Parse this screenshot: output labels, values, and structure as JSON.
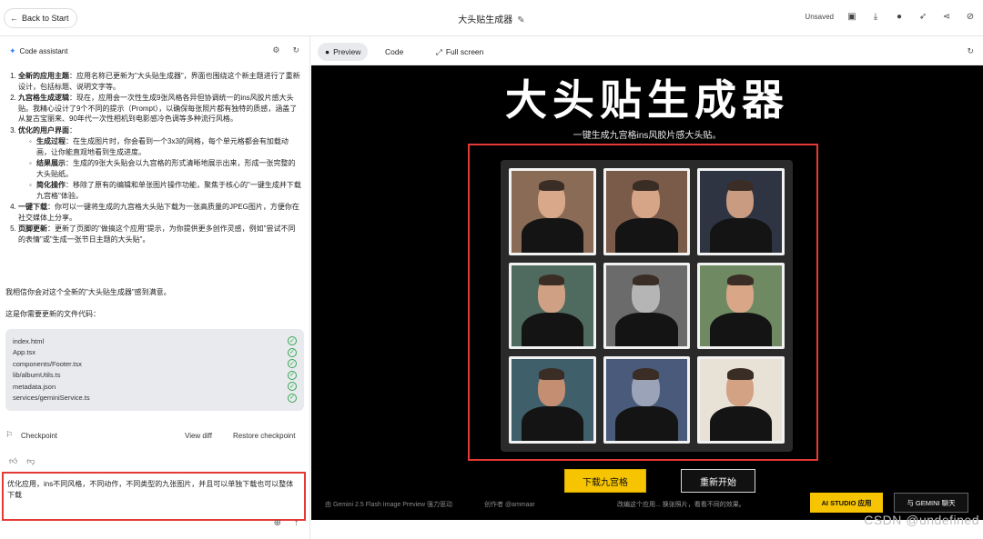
{
  "topbar": {
    "back_label": "Back to Start",
    "app_title": "大头贴生成器",
    "unsaved_label": "Unsaved"
  },
  "left_panel": {
    "assistant_label": "Code assistant",
    "message": {
      "items": [
        {
          "title": "全新的应用主题",
          "text": "：应用名称已更新为\"大头贴生成器\"，界面也围绕这个新主题进行了重新设计，包括标题、说明文字等。"
        },
        {
          "title": "九宫格生成逻辑",
          "text": "：现在，应用会一次性生成9张风格各异但协调统一的ins风胶片感大头贴。我精心设计了9个不同的提示（Prompt），以确保每张照片都有独特的质感，涵盖了从复古宝丽来、90年代一次性相机到电影感冷色调等多种流行风格。"
        },
        {
          "title": "优化的用户界面",
          "text": "：",
          "sub": [
            {
              "title": "生成过程",
              "text": "：在生成图片时，你会看到一个3x3的网格，每个单元格都会有加载动画，让你能直观地看到生成进度。"
            },
            {
              "title": "结果展示",
              "text": "：生成的9张大头贴会以九宫格的形式清晰地展示出来，形成一张完整的大头贴纸。"
            },
            {
              "title": "简化操作",
              "text": "：移除了原有的编辑和单张图片操作功能，聚焦于核心的\"一键生成并下载九宫格\"体验。"
            }
          ]
        },
        {
          "title": "一键下载",
          "text": "：你可以一键将生成的九宫格大头贴下载为一张高质量的JPEG图片，方便你在社交媒体上分享。"
        },
        {
          "title": "页脚更新",
          "text": "：更新了页脚的\"做搞这个应用\"提示，为你提供更多创作灵感，例如\"尝试不同的表情\"或\"生成一张节日主题的大头贴\"。"
        }
      ],
      "closing": "我相信你会对这个全新的\"大头贴生成器\"感到满意。",
      "files_intro": "这是你需要更新的文件代码："
    },
    "files": [
      "index.html",
      "App.tsx",
      "components/Footer.tsx",
      "lib/albumUtils.ts",
      "metadata.json",
      "services/geminiService.ts"
    ],
    "checkpoint": {
      "label": "Checkpoint",
      "view_diff": "View diff",
      "restore": "Restore checkpoint"
    },
    "prompt_text": "优化应用，ins不同风格，不同动作，不同类型的九张图片，并且可以单独下载也可以整体下载"
  },
  "right_panel": {
    "tabs": {
      "preview": "Preview",
      "code": "Code",
      "full_screen": "Full screen"
    },
    "app": {
      "title": "大头贴生成器",
      "subtitle": "一键生成九宫格ins风胶片感大头贴。",
      "download_button": "下载九宫格",
      "restart_button": "重新开始",
      "footer_left": "由 Gemini 2.5 Flash Image Preview 强力驱动",
      "footer_creator": "创作者 @ammaar",
      "footer_hint": "改编这个应用... 换张照片，看看不同的效果。",
      "studio_button": "AI STUDIO 应用",
      "gemini_button": "与 GEMINI 聊天"
    },
    "photos": [
      {
        "bg": "#8a6b55",
        "face": "#d9a88a"
      },
      {
        "bg": "#7a5a48",
        "face": "#d6a587"
      },
      {
        "bg": "#2e3442",
        "face": "#c99b80"
      },
      {
        "bg": "#4f6a5e",
        "face": "#cfa084"
      },
      {
        "bg": "#6b6b6b",
        "face": "#b5b5b5"
      },
      {
        "bg": "#6f8a63",
        "face": "#d9a688"
      },
      {
        "bg": "#3f5f6a",
        "face": "#c48e72"
      },
      {
        "bg": "#4a5a7a",
        "face": "#9aa3b8"
      },
      {
        "bg": "#e8e2d6",
        "face": "#d3a183"
      }
    ]
  },
  "watermark": "CSDN @undefined",
  "colors": {
    "accent_yellow": "#f6c400",
    "highlight_red": "#e53935",
    "check_green": "#34a853"
  }
}
